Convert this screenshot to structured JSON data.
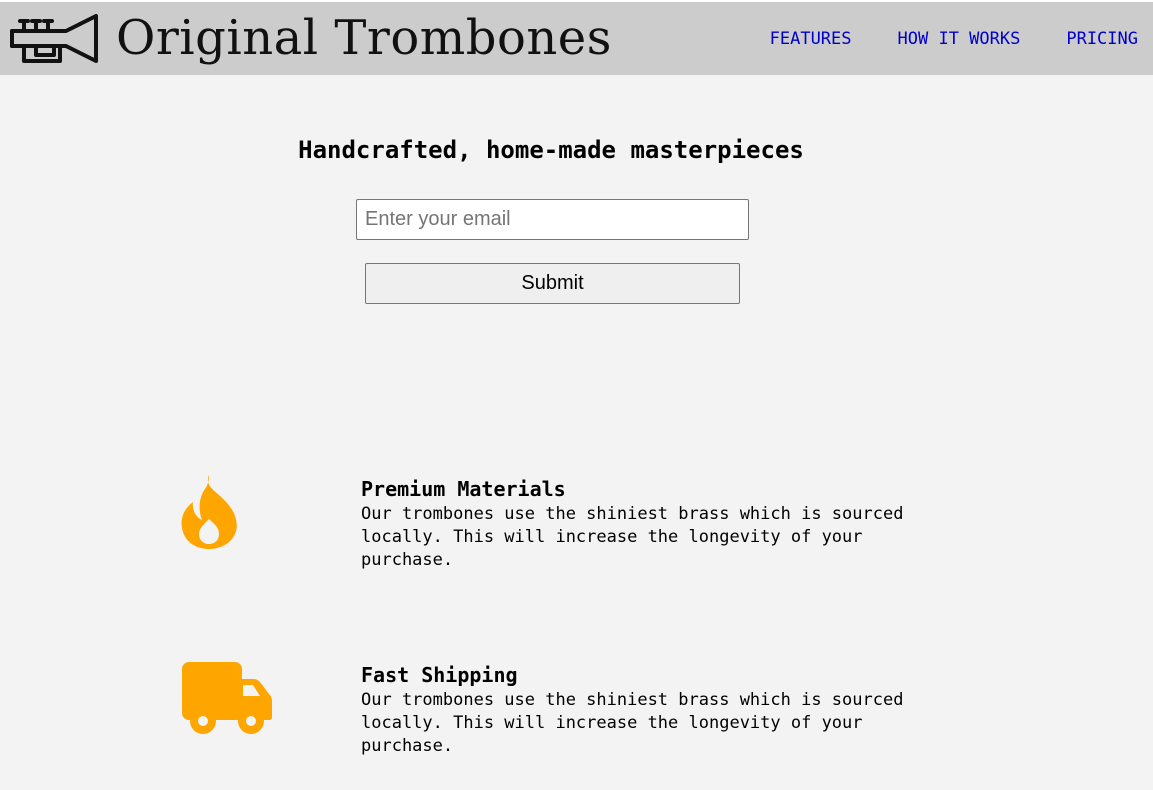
{
  "header": {
    "brand": "Original Trombones",
    "logo_icon": "trumpet-icon",
    "nav": [
      "FEATURES",
      "HOW IT WORKS",
      "PRICING"
    ],
    "nav_color": "#0000cc",
    "background": "#cccccc"
  },
  "hero": {
    "title": "Handcrafted, home-made masterpieces",
    "email_placeholder": "Enter your email",
    "email_value": "",
    "submit_label": "Submit"
  },
  "features": [
    {
      "icon": "fire-icon",
      "title": "Premium Materials",
      "description": "Our trombones use the shiniest brass which is sourced locally. This will increase the longevity of your purchase."
    },
    {
      "icon": "truck-icon",
      "title": "Fast Shipping",
      "description": "Our trombones use the shiniest brass which is sourced locally. This will increase the longevity of your purchase."
    }
  ],
  "colors": {
    "accent_icon": "#ffa500",
    "page_background": "#f3f3f3"
  }
}
